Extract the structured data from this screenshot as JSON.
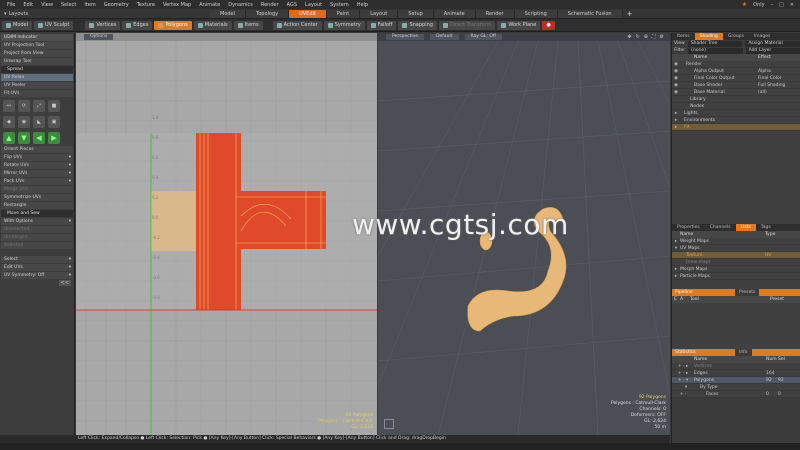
{
  "menubar": {
    "items": [
      "File",
      "Edit",
      "View",
      "Select",
      "Item",
      "Geometry",
      "Texture",
      "Vertex Map",
      "Animate",
      "Dynamics",
      "Render",
      "AGS",
      "Layout",
      "System",
      "Help"
    ],
    "only_label": "Only"
  },
  "layouts": {
    "label": "Layouts",
    "tabs": [
      "Model",
      "Topology",
      "UVEdit",
      "Paint",
      "Layout",
      "Setup",
      "Animate",
      "Render",
      "Scripting",
      "Schematic Fusion"
    ],
    "active_tab": "UVEdit"
  },
  "toolbar": {
    "items": [
      "Model",
      "UV Sculpt",
      "Vertices",
      "Edges",
      "Polygons",
      "Materials",
      "Items",
      "Action Center",
      "Symmetry",
      "Falloff",
      "Snapping",
      "Direct Transform",
      "Work Plane"
    ],
    "active": "Polygons"
  },
  "leftpanel": {
    "header": "UDIM Indicator",
    "top_buttons": [
      "UV Projection Tool",
      "Project from View",
      "Unwrap Tool"
    ],
    "spread_section": "Spread",
    "uv_buttons": [
      "UV Relax",
      "UV Peeler",
      "Fit UVs"
    ],
    "orient_buttons": [
      "Orient Pieces",
      "Flip UVs",
      "Rotate UVs",
      "Mirror UVs",
      "Pack UVs",
      "Merge UVs",
      "Symmetrize UVs",
      "Rectangle"
    ],
    "move_sew": "Move and Sew",
    "with_options": "With Options",
    "dim_buttons": [
      "Unselected",
      "Unmerged",
      "Selected"
    ],
    "bottom_buttons": [
      "Select",
      "Edit UVs",
      "UV Symmetry: Off"
    ]
  },
  "uvport": {
    "options_label": "Options",
    "axis_labels": [
      "1.0",
      "0.8",
      "0.6",
      "0.4",
      "0.2",
      "0.0",
      "-0.2",
      "-0.4",
      "-0.6",
      "-0.8"
    ],
    "readout": [
      "92 Polygons",
      "Polygons : Catmull-Clark",
      "GL: 2,624"
    ]
  },
  "port3d": {
    "view_label": "Perspective",
    "shading_label": "Default",
    "raygl_label": "Ray GL: Off",
    "readout": [
      "92 Polygons",
      "Polygons : Catmull-Clark",
      "Channels: 0",
      "Deformers: OFF",
      "GL: 2,624",
      "50 m"
    ]
  },
  "rightpanel": {
    "top_tabs": [
      "Items",
      "Shading",
      "Groups",
      "Images"
    ],
    "active_top_tab": "Shading",
    "view_label": "View",
    "view_value": "Shader Tree",
    "filter_label": "Filter",
    "filter_value": "(none)",
    "assign_material": "Assign Material",
    "add_layer": "Add Layer",
    "tree_headers": [
      "Name",
      "Effect"
    ],
    "tree": [
      {
        "name": "Render",
        "effect": ""
      },
      {
        "name": "Alpha Output",
        "effect": "Alpha"
      },
      {
        "name": "Final Color Output",
        "effect": "Final Color"
      },
      {
        "name": "Base Shader",
        "effect": "Full Shading"
      },
      {
        "name": "Base Material",
        "effect": "(all)"
      },
      {
        "name": "Library",
        "effect": ""
      },
      {
        "name": "Nodes",
        "effect": ""
      },
      {
        "name": "Lights",
        "effect": ""
      },
      {
        "name": "Environments",
        "effect": ""
      },
      {
        "name": "FX",
        "effect": ""
      }
    ],
    "mid_tabs": [
      "Properties",
      "Channels",
      "Lists",
      "Tags"
    ],
    "active_mid_tab": "Lists",
    "list_headers": [
      "Name",
      "Type"
    ],
    "lists": [
      {
        "name": "Weight Maps",
        "type": ""
      },
      {
        "name": "UV Maps",
        "type": ""
      },
      {
        "name": "Texture",
        "type": "UV"
      },
      {
        "name": "(new map)",
        "type": ""
      },
      {
        "name": "Morph Maps",
        "type": ""
      },
      {
        "name": "Particle Maps",
        "type": ""
      }
    ],
    "pipeline_label": "Pipeline",
    "presets_label": "Presets",
    "tool_headers": [
      "E",
      "A",
      "Tool",
      "Preset"
    ],
    "stats_label": "Statistics",
    "info_label": "Info",
    "stats_headers": [
      "Name",
      "Num",
      "Sel"
    ],
    "stats": [
      {
        "name": "Vertices",
        "num": "",
        "sel": ""
      },
      {
        "name": "Edges",
        "num": "164",
        "sel": ""
      },
      {
        "name": "Polygons",
        "num": "92",
        "sel": "92"
      },
      {
        "name": "By Type",
        "num": "",
        "sel": ""
      },
      {
        "name": "Faces",
        "num": "0",
        "sel": "0"
      }
    ]
  },
  "statusbar": {
    "text": "Left Click: Expand/Collapse ● Left Click: Selection: Pick ● [Any Key]-[Any Button] Click: Special Behaviors ● [Any Key]-[Any Button] Click and Drag: dragDropBegin"
  },
  "watermark": "www.cgtsj.com",
  "colors": {
    "accent": "#e07a1e",
    "uv_island": "#e04a2a",
    "uv_island_back": "#d9b98a",
    "mesh": "#e8b878"
  }
}
